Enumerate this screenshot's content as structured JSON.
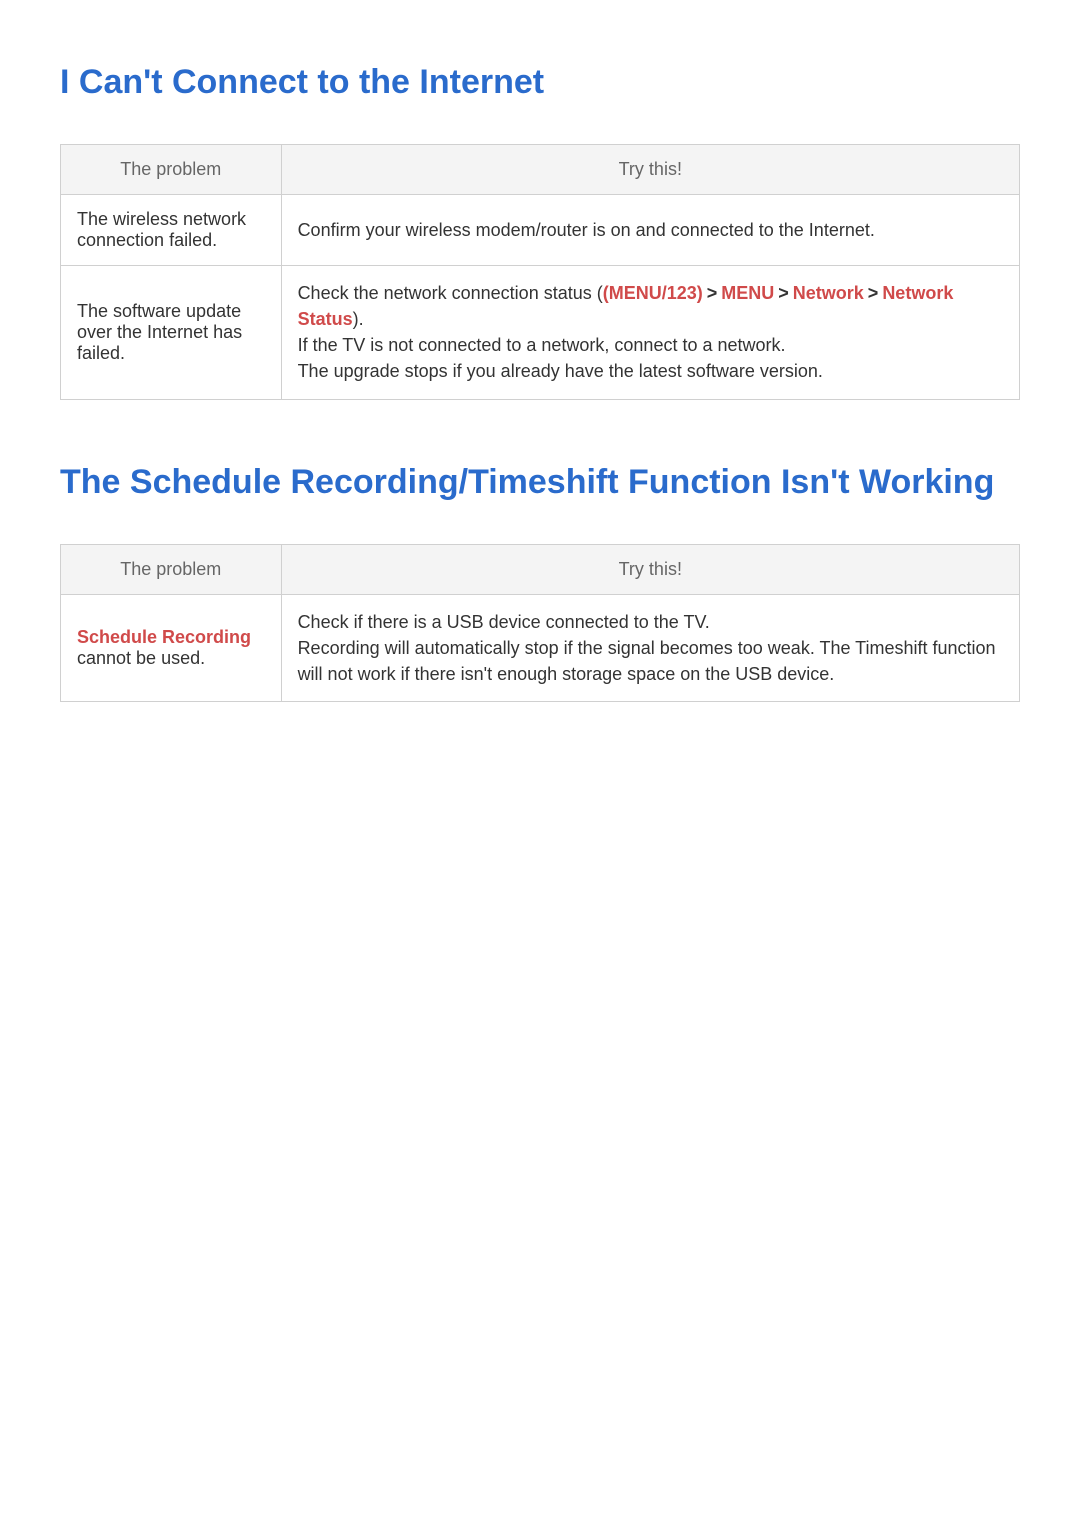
{
  "sections": [
    {
      "title": "I Can't Connect to the Internet",
      "headers": {
        "problem": "The problem",
        "try": "Try this!"
      },
      "rows": [
        {
          "problem": "The wireless network connection failed.",
          "trythis_html": "Confirm your wireless modem/router is on and connected to the Internet."
        },
        {
          "problem": "The software update over the Internet has failed.",
          "trythis_html": "Check the network connection status (<span class=\"menu-path\">(MENU/123)<span class=\"sep\">&gt;</span>MENU<span class=\"sep\">&gt;</span>Network<span class=\"sep\">&gt;</span>Network Status</span>).<br>If the TV is not connected to a network, connect to a network.<br>The upgrade stops if you already have the latest software version."
        }
      ]
    },
    {
      "title": "The Schedule Recording/Timeshift Function Isn't Working",
      "headers": {
        "problem": "The problem",
        "try": "Try this!"
      },
      "rows": [
        {
          "problem_html": "<span class=\"sched\">Schedule Recording</span> cannot be used.",
          "trythis_html": "Check if there is a USB device connected to the TV.<br>Recording will automatically stop if the signal becomes too weak. The Timeshift function will not work if there isn't enough storage space on the USB device."
        }
      ]
    }
  ]
}
